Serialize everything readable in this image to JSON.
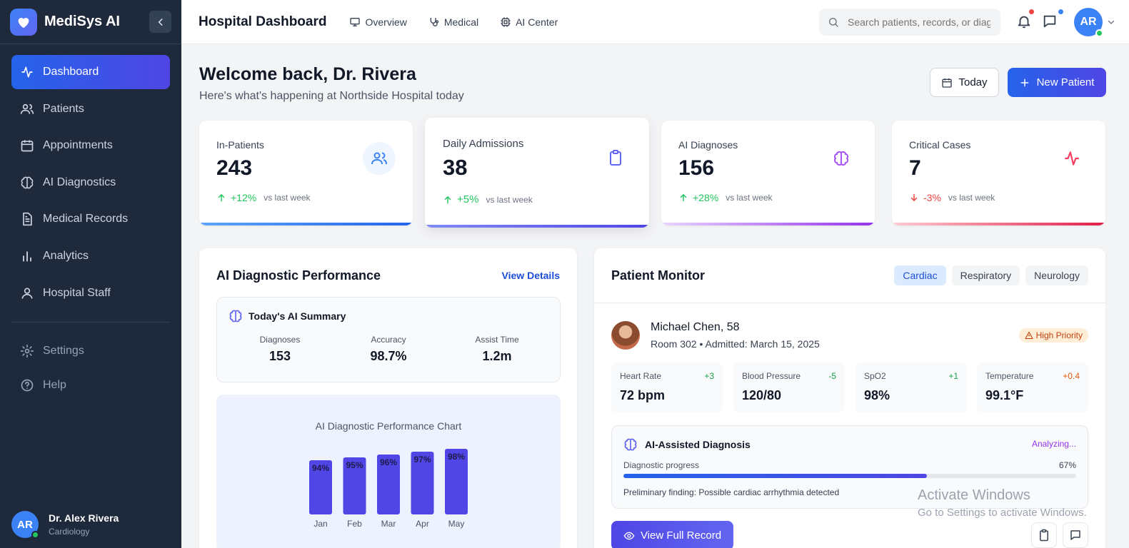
{
  "app": {
    "name": "MediSys AI"
  },
  "sidebar": {
    "items": [
      {
        "label": "Dashboard",
        "icon": "activity-icon"
      },
      {
        "label": "Patients",
        "icon": "users-icon"
      },
      {
        "label": "Appointments",
        "icon": "calendar-icon"
      },
      {
        "label": "AI Diagnostics",
        "icon": "brain-icon"
      },
      {
        "label": "Medical Records",
        "icon": "file-icon"
      },
      {
        "label": "Analytics",
        "icon": "bar-chart-icon"
      },
      {
        "label": "Hospital Staff",
        "icon": "user-icon"
      }
    ],
    "secondary": [
      {
        "label": "Settings",
        "icon": "gear-icon"
      },
      {
        "label": "Help",
        "icon": "help-icon"
      }
    ],
    "user": {
      "initials": "AR",
      "name": "Dr. Alex Rivera",
      "role": "Cardiology"
    }
  },
  "header": {
    "title": "Hospital Dashboard",
    "links": [
      {
        "label": "Overview",
        "icon": "monitor-icon"
      },
      {
        "label": "Medical",
        "icon": "stethoscope-icon"
      },
      {
        "label": "AI Center",
        "icon": "cpu-icon"
      }
    ],
    "search_placeholder": "Search patients, records, or diagnoses...",
    "avatar_initials": "AR"
  },
  "welcome": {
    "title": "Welcome back, Dr. Rivera",
    "subtitle": "Here's what's happening at Northside Hospital today",
    "today_label": "Today",
    "new_patient_label": "New Patient"
  },
  "stats": [
    {
      "label": "In-Patients",
      "value": "243",
      "trend": "+12%",
      "vs": "vs last week",
      "direction": "up",
      "color": "#22c55e"
    },
    {
      "label": "Daily Admissions",
      "value": "38",
      "trend": "+5%",
      "vs": "vs last week",
      "direction": "up",
      "color": "#22c55e"
    },
    {
      "label": "AI Diagnoses",
      "value": "156",
      "trend": "+28%",
      "vs": "vs last week",
      "direction": "up",
      "color": "#22c55e"
    },
    {
      "label": "Critical Cases",
      "value": "7",
      "trend": "-3%",
      "vs": "vs last week",
      "direction": "down",
      "color": "#ef4444"
    }
  ],
  "ai_performance": {
    "title": "AI Diagnostic Performance",
    "view_details": "View Details",
    "summary_title": "Today's AI Summary",
    "summary": [
      {
        "label": "Diagnoses",
        "value": "153"
      },
      {
        "label": "Accuracy",
        "value": "98.7%"
      },
      {
        "label": "Assist Time",
        "value": "1.2m"
      }
    ],
    "chart_title": "AI Diagnostic Performance Chart"
  },
  "chart_data": {
    "type": "bar",
    "title": "AI Diagnostic Performance Chart",
    "categories": [
      "Jan",
      "Feb",
      "Mar",
      "Apr",
      "May"
    ],
    "values": [
      94,
      95,
      96,
      97,
      98
    ],
    "labels": [
      "94%",
      "95%",
      "96%",
      "97%",
      "98%"
    ],
    "ylim": [
      75,
      100
    ],
    "color": "#4f46e5"
  },
  "patient_monitor": {
    "title": "Patient Monitor",
    "tabs": [
      "Cardiac",
      "Respiratory",
      "Neurology"
    ],
    "active_tab": "Cardiac",
    "patient": {
      "name": "Michael Chen, 58",
      "meta": "Room 302 • Admitted: March 15, 2025"
    },
    "priority": "High Priority",
    "vitals": [
      {
        "label": "Heart Rate",
        "value": "72 bpm",
        "delta": "+3",
        "color": "#16a34a"
      },
      {
        "label": "Blood Pressure",
        "value": "120/80",
        "delta": "-5",
        "color": "#16a34a"
      },
      {
        "label": "SpO2",
        "value": "98%",
        "delta": "+1",
        "color": "#16a34a"
      },
      {
        "label": "Temperature",
        "value": "99.1°F",
        "delta": "+0.4",
        "color": "#ea580c"
      }
    ],
    "ai": {
      "title": "AI-Assisted Diagnosis",
      "status": "Analyzing...",
      "progress_label": "Diagnostic progress",
      "progress_value": "67%",
      "progress": 0.67,
      "finding": "Preliminary finding: Possible cardiac arrhythmia detected"
    },
    "view_record": "View Full Record"
  },
  "watermark": {
    "line1": "Activate Windows",
    "line2": "Go to Settings to activate Windows."
  }
}
